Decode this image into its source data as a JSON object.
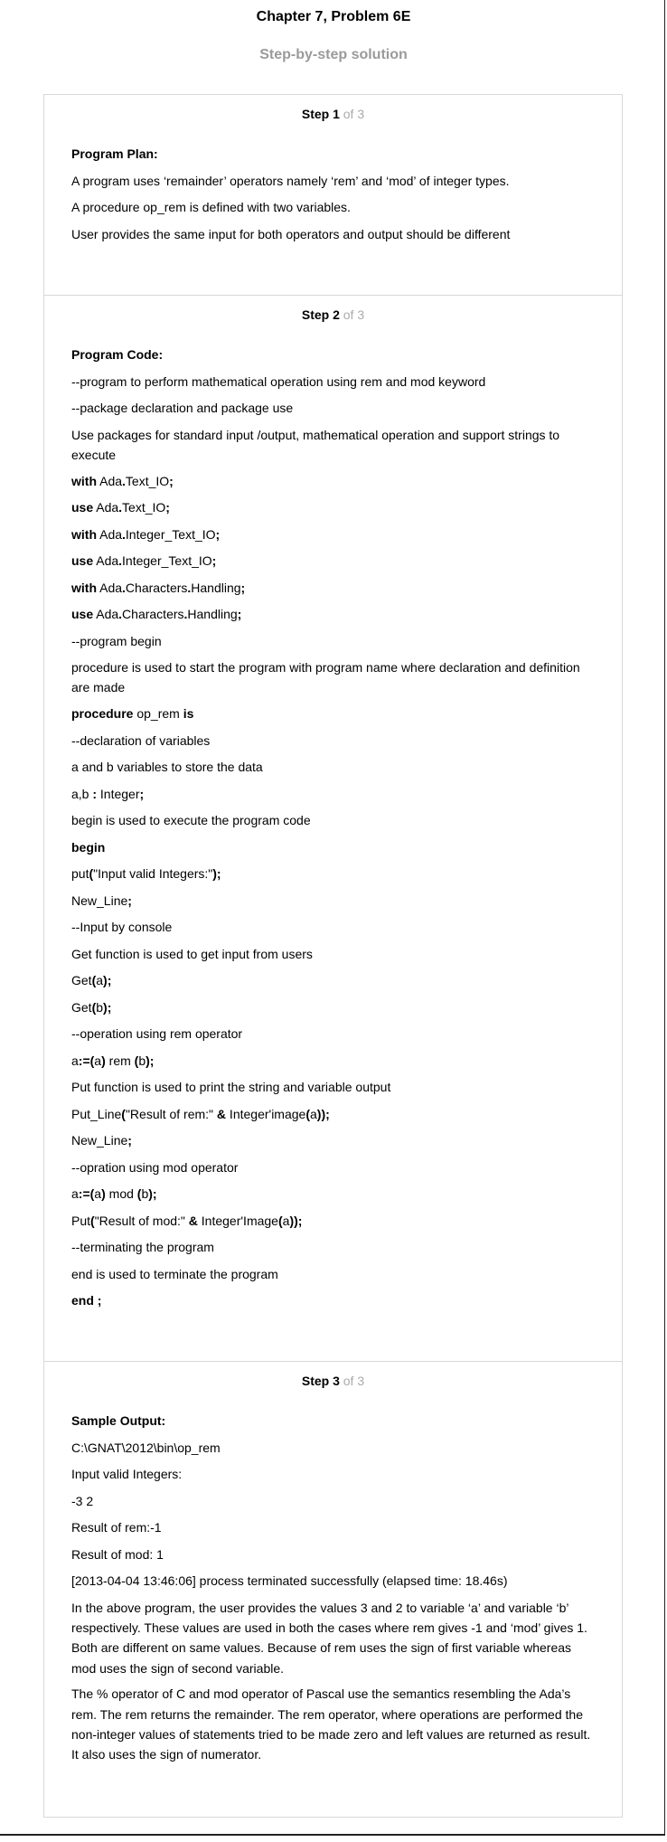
{
  "header": {
    "title": "Chapter 7, Problem 6E",
    "subtitle": "Step-by-step solution"
  },
  "steps": [
    {
      "step_word": "Step 1",
      "of_text": " of 3",
      "lines": [
        {
          "kind": "sec",
          "text": "Program Plan:"
        },
        {
          "kind": "text",
          "text": "A program uses ‘remainder’ operators namely ‘rem’ and ‘mod’ of integer types."
        },
        {
          "kind": "text",
          "text": "A procedure op_rem is defined with two variables."
        },
        {
          "kind": "text",
          "text": "User provides the same input for both operators and output should be different"
        }
      ]
    },
    {
      "step_word": "Step 2",
      "of_text": " of 3",
      "lines": [
        {
          "kind": "sec",
          "text": "Program Code:"
        },
        {
          "kind": "text",
          "text": "--program to perform mathematical operation using rem and mod keyword"
        },
        {
          "kind": "text",
          "text": "--package declaration and package use"
        },
        {
          "kind": "wrap",
          "text": "Use packages for standard input /output, mathematical operation and support strings to execute"
        },
        {
          "kind": "code",
          "parts": [
            {
              "b": true,
              "t": "with"
            },
            {
              "t": " Ada"
            },
            {
              "b": true,
              "t": "."
            },
            {
              "t": "Text_IO"
            },
            {
              "b": true,
              "t": ";"
            }
          ]
        },
        {
          "kind": "code",
          "parts": [
            {
              "b": true,
              "t": "use"
            },
            {
              "t": " Ada"
            },
            {
              "b": true,
              "t": "."
            },
            {
              "t": "Text_IO"
            },
            {
              "b": true,
              "t": ";"
            }
          ]
        },
        {
          "kind": "code",
          "parts": [
            {
              "b": true,
              "t": "with"
            },
            {
              "t": " Ada"
            },
            {
              "b": true,
              "t": "."
            },
            {
              "t": "Integer_Text_IO"
            },
            {
              "b": true,
              "t": ";"
            }
          ]
        },
        {
          "kind": "code",
          "parts": [
            {
              "b": true,
              "t": "use"
            },
            {
              "t": " Ada"
            },
            {
              "b": true,
              "t": "."
            },
            {
              "t": "Integer_Text_IO"
            },
            {
              "b": true,
              "t": ";"
            }
          ]
        },
        {
          "kind": "code",
          "parts": [
            {
              "b": true,
              "t": "with"
            },
            {
              "t": " Ada"
            },
            {
              "b": true,
              "t": "."
            },
            {
              "t": "Characters"
            },
            {
              "b": true,
              "t": "."
            },
            {
              "t": "Handling"
            },
            {
              "b": true,
              "t": ";"
            }
          ]
        },
        {
          "kind": "code",
          "parts": [
            {
              "b": true,
              "t": "use"
            },
            {
              "t": " Ada"
            },
            {
              "b": true,
              "t": "."
            },
            {
              "t": "Characters"
            },
            {
              "b": true,
              "t": "."
            },
            {
              "t": "Handling"
            },
            {
              "b": true,
              "t": ";"
            }
          ]
        },
        {
          "kind": "text",
          "text": "--program begin"
        },
        {
          "kind": "wrap",
          "text": "procedure is used to start the program with program name where declaration and definition are made"
        },
        {
          "kind": "code",
          "parts": [
            {
              "b": true,
              "t": "procedure"
            },
            {
              "t": " op_rem "
            },
            {
              "b": true,
              "t": "is"
            }
          ]
        },
        {
          "kind": "text",
          "text": "--declaration of variables"
        },
        {
          "kind": "text",
          "text": "a and b variables to store the data"
        },
        {
          "kind": "code",
          "parts": [
            {
              "t": "a,b "
            },
            {
              "b": true,
              "t": ":"
            },
            {
              "t": " Integer"
            },
            {
              "b": true,
              "t": ";"
            }
          ]
        },
        {
          "kind": "text",
          "text": "begin is used to execute the program code"
        },
        {
          "kind": "code",
          "parts": [
            {
              "b": true,
              "t": "begin"
            }
          ]
        },
        {
          "kind": "code",
          "parts": [
            {
              "t": "put"
            },
            {
              "b": true,
              "t": "("
            },
            {
              "t": "\"Input valid Integers:\""
            },
            {
              "b": true,
              "t": ");"
            }
          ]
        },
        {
          "kind": "code",
          "parts": [
            {
              "t": "New_Line"
            },
            {
              "b": true,
              "t": ";"
            }
          ]
        },
        {
          "kind": "text",
          "text": "--Input by console"
        },
        {
          "kind": "text",
          "text": "Get function is used to get input from users"
        },
        {
          "kind": "code",
          "parts": [
            {
              "t": "Get"
            },
            {
              "b": true,
              "t": "("
            },
            {
              "t": "a"
            },
            {
              "b": true,
              "t": ");"
            }
          ]
        },
        {
          "kind": "code",
          "parts": [
            {
              "t": "Get"
            },
            {
              "b": true,
              "t": "("
            },
            {
              "t": "b"
            },
            {
              "b": true,
              "t": ");"
            }
          ]
        },
        {
          "kind": "text",
          "text": "--operation using rem operator"
        },
        {
          "kind": "code",
          "parts": [
            {
              "t": "a"
            },
            {
              "b": true,
              "t": ":=("
            },
            {
              "t": "a"
            },
            {
              "b": true,
              "t": ")"
            },
            {
              "t": " rem "
            },
            {
              "b": true,
              "t": "("
            },
            {
              "t": "b"
            },
            {
              "b": true,
              "t": ");"
            }
          ]
        },
        {
          "kind": "text",
          "text": "Put function is used to print the string and variable output"
        },
        {
          "kind": "code",
          "parts": [
            {
              "t": "Put_Line"
            },
            {
              "b": true,
              "t": "("
            },
            {
              "t": "\"Result of rem:\" "
            },
            {
              "b": true,
              "t": "&"
            },
            {
              "t": " Integer'image"
            },
            {
              "b": true,
              "t": "("
            },
            {
              "t": "a"
            },
            {
              "b": true,
              "t": "));"
            }
          ]
        },
        {
          "kind": "code",
          "parts": [
            {
              "t": "New_Line"
            },
            {
              "b": true,
              "t": ";"
            }
          ]
        },
        {
          "kind": "text",
          "text": "--opration using mod operator"
        },
        {
          "kind": "code",
          "parts": [
            {
              "t": "a"
            },
            {
              "b": true,
              "t": ":=("
            },
            {
              "t": "a"
            },
            {
              "b": true,
              "t": ")"
            },
            {
              "t": " mod "
            },
            {
              "b": true,
              "t": "("
            },
            {
              "t": "b"
            },
            {
              "b": true,
              "t": ");"
            }
          ]
        },
        {
          "kind": "code",
          "parts": [
            {
              "t": "Put"
            },
            {
              "b": true,
              "t": "("
            },
            {
              "t": "\"Result of mod:\" "
            },
            {
              "b": true,
              "t": "&"
            },
            {
              "t": " Integer'Image"
            },
            {
              "b": true,
              "t": "("
            },
            {
              "t": "a"
            },
            {
              "b": true,
              "t": "));"
            }
          ]
        },
        {
          "kind": "text",
          "text": "--terminating the program"
        },
        {
          "kind": "text",
          "text": "end is used to terminate the program"
        },
        {
          "kind": "code",
          "parts": [
            {
              "b": true,
              "t": "end ;"
            }
          ]
        }
      ]
    },
    {
      "step_word": "Step 3",
      "of_text": " of 3",
      "lines": [
        {
          "kind": "sec",
          "text": "Sample Output:"
        },
        {
          "kind": "text",
          "text": "C:\\GNAT\\2012\\bin\\op_rem"
        },
        {
          "kind": "text",
          "text": "Input valid Integers:"
        },
        {
          "kind": "text",
          "text": "-3 2"
        },
        {
          "kind": "text",
          "text": "Result of rem:-1"
        },
        {
          "kind": "text",
          "text": "Result of mod: 1"
        },
        {
          "kind": "text",
          "text": "[2013-04-04 13:46:06] process terminated successfully (elapsed time: 18.46s)"
        },
        {
          "kind": "wrap",
          "text": "In the above program, the user provides the values 3 and 2 to variable ‘a’ and variable ‘b’ respectively. These values are used in both the cases where rem gives -1 and ‘mod’ gives 1. Both are different on same values. Because of rem uses the sign of first variable whereas mod uses the sign of second variable."
        },
        {
          "kind": "wrap",
          "text": "The % operator of C and mod operator of Pascal use the semantics resembling the Ada’s rem. The rem returns the remainder. The rem operator, where operations are performed the non-integer values of statements tried to be made zero and left values are returned as result. It also uses the sign of numerator."
        }
      ]
    }
  ]
}
